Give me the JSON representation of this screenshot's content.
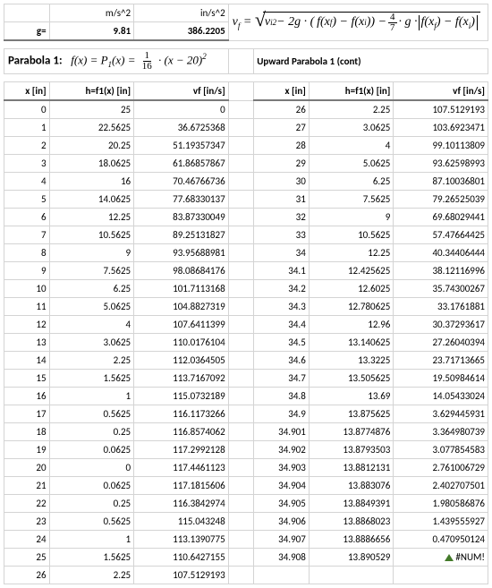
{
  "top": {
    "ms2": "m/s^2",
    "ins2": "in/s^2",
    "g_label": "g=",
    "g_ms2": "9.81",
    "g_ins2": "386.2205"
  },
  "titles": {
    "p1": "Parabola 1:",
    "p1cont": "Upward Parabola 1 (cont)"
  },
  "headers": {
    "x": "x [in]",
    "h": "h=f1(x)  [in]",
    "vf": "vf [in/s]"
  },
  "left_rows": [
    [
      "0",
      "25",
      "0"
    ],
    [
      "1",
      "22.5625",
      "36.6725368"
    ],
    [
      "2",
      "20.25",
      "51.19357347"
    ],
    [
      "3",
      "18.0625",
      "61.86857867"
    ],
    [
      "4",
      "16",
      "70.46766736"
    ],
    [
      "5",
      "14.0625",
      "77.68330137"
    ],
    [
      "6",
      "12.25",
      "83.87330049"
    ],
    [
      "7",
      "10.5625",
      "89.25131827"
    ],
    [
      "8",
      "9",
      "93.95688981"
    ],
    [
      "9",
      "7.5625",
      "98.08684176"
    ],
    [
      "10",
      "6.25",
      "101.7113168"
    ],
    [
      "11",
      "5.0625",
      "104.8827319"
    ],
    [
      "12",
      "4",
      "107.6411399"
    ],
    [
      "13",
      "3.0625",
      "110.0176104"
    ],
    [
      "14",
      "2.25",
      "112.0364505"
    ],
    [
      "15",
      "1.5625",
      "113.7167092"
    ],
    [
      "16",
      "1",
      "115.0732189"
    ],
    [
      "17",
      "0.5625",
      "116.1173266"
    ],
    [
      "18",
      "0.25",
      "116.8574062"
    ],
    [
      "19",
      "0.0625",
      "117.2992128"
    ],
    [
      "20",
      "0",
      "117.4461123"
    ],
    [
      "21",
      "0.0625",
      "117.1815606"
    ],
    [
      "22",
      "0.25",
      "116.3842974"
    ],
    [
      "23",
      "0.5625",
      "115.043248"
    ],
    [
      "24",
      "1",
      "113.1390775"
    ],
    [
      "25",
      "1.5625",
      "110.6427155"
    ],
    [
      "26",
      "2.25",
      "107.5129193"
    ]
  ],
  "right_rows": [
    [
      "26",
      "2.25",
      "107.5129193"
    ],
    [
      "27",
      "3.0625",
      "103.6923471"
    ],
    [
      "28",
      "4",
      "99.10113809"
    ],
    [
      "29",
      "5.0625",
      "93.62598993"
    ],
    [
      "30",
      "6.25",
      "87.10036801"
    ],
    [
      "31",
      "7.5625",
      "79.26525039"
    ],
    [
      "32",
      "9",
      "69.68029441"
    ],
    [
      "33",
      "10.5625",
      "57.47664425"
    ],
    [
      "34",
      "12.25",
      "40.34406444"
    ],
    [
      "34.1",
      "12.425625",
      "38.12116996"
    ],
    [
      "34.2",
      "12.6025",
      "35.74300267"
    ],
    [
      "34.3",
      "12.780625",
      "33.1761881"
    ],
    [
      "34.4",
      "12.96",
      "30.37293617"
    ],
    [
      "34.5",
      "13.140625",
      "27.26040394"
    ],
    [
      "34.6",
      "13.3225",
      "23.71713665"
    ],
    [
      "34.7",
      "13.505625",
      "19.50984614"
    ],
    [
      "34.8",
      "13.69",
      "14.05433024"
    ],
    [
      "34.9",
      "13.875625",
      "3.629445931"
    ],
    [
      "34.901",
      "13.8774876",
      "3.364980739"
    ],
    [
      "34.902",
      "13.8793503",
      "3.077854583"
    ],
    [
      "34.903",
      "13.8812131",
      "2.761006729"
    ],
    [
      "34.904",
      "13.883076",
      "2.402707501"
    ],
    [
      "34.905",
      "13.8849391",
      "1.980586876"
    ],
    [
      "34.906",
      "13.8868023",
      "1.439555927"
    ],
    [
      "34.907",
      "13.8886656",
      "0.470950124"
    ],
    [
      "34.908",
      "13.890529",
      "#NUM!"
    ]
  ]
}
